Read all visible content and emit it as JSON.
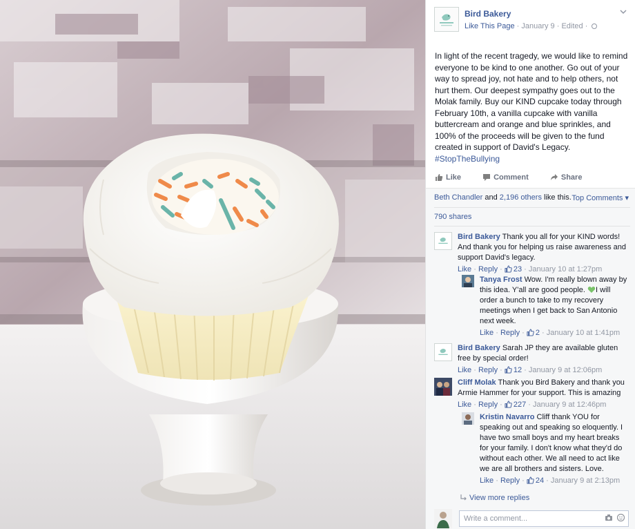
{
  "colors": {
    "brand_link": "#3b5998",
    "text": "#141823",
    "meta": "#9197a3",
    "ufi_bg": "#f6f7f8",
    "accent_green": "#7ac36a"
  },
  "photo": {
    "alt_icon": "cupcake-photo"
  },
  "post": {
    "page_name": "Bird Bakery",
    "like_page": "Like This Page",
    "date": "January 9",
    "edited": "Edited",
    "text": "In light of the recent tragedy, we would like to remind everyone to be kind to one another. Go out of your way to spread joy, not hate and to help others, not hurt them. Our deepest sympathy goes out to the Molak family. Buy our KIND cupcake today through February 10th, a vanilla cupcake with vanilla buttercream and orange and blue sprinkles, and 100% of the proceeds will be given to the fund created in support of David's Legacy.",
    "hashtag": "#StopTheBullying",
    "actions": {
      "like": "Like",
      "comment": "Comment",
      "share": "Share"
    }
  },
  "ufi": {
    "likes_name": "Beth Chandler",
    "likes_rest": " and ",
    "likes_others": "2,196 others",
    "likes_tail": " like this.",
    "top_comments": "Top Comments",
    "shares": "790 shares",
    "view_more": "View more replies",
    "write_placeholder": "Write a comment..."
  },
  "comments": [
    {
      "name": "Bird Bakery",
      "text": "Thank you all for your KIND words! And thank you for helping us raise awareness and support David's legacy.",
      "like": "Like",
      "reply": "Reply",
      "count": "23",
      "time": "January 10 at 1:27pm"
    },
    {
      "name": "Tanya Frost",
      "text": "Wow. I'm really blown away by this idea. Y'all are good people. ",
      "text2": "I will order a bunch to take to my recovery meetings when I get back to San Antonio next week.",
      "like": "Like",
      "reply": "Reply",
      "count": "2",
      "time": "January 10 at 1:41pm"
    },
    {
      "name": "Bird Bakery",
      "text": "Sarah JP they are available gluten free by special order!",
      "like": "Like",
      "reply": "Reply",
      "count": "12",
      "time": "January 9 at 12:06pm"
    },
    {
      "name": "Cliff Molak",
      "text": "Thank you Bird Bakery and thank you Armie Hammer for your support. This is amazing",
      "like": "Like",
      "reply": "Reply",
      "count": "227",
      "time": "January 9 at 12:46pm"
    },
    {
      "name": "Kristin Navarro",
      "text": "Cliff thank YOU for speaking out and speaking so eloquently. I have two small boys and my heart breaks for your family. I don't know what they'd do without each other. We all need to act like we are all brothers and sisters. Love.",
      "like": "Like",
      "reply": "Reply",
      "count": "24",
      "time": "January 9 at 2:13pm"
    }
  ],
  "sep": " · "
}
